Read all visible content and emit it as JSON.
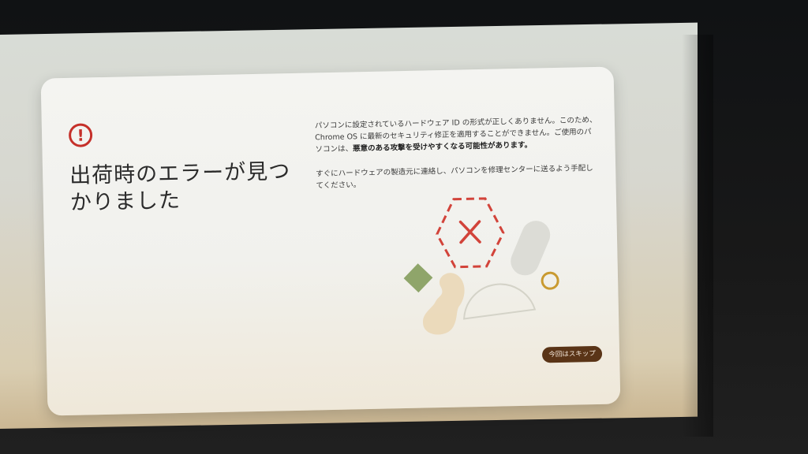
{
  "dialog": {
    "title": "出荷時のエラーが見つかりました",
    "description": {
      "p1_normal": "パソコンに設定されているハードウェア ID の形式が正しくありません。このため、Chrome OS に最新のセキュリティ修正を適用することができません。ご使用のパソコンは、",
      "p1_bold": "悪意のある攻撃を受けやすくなる可能性があります。",
      "p2": "すぐにハードウェアの製造元に連絡し、パソコンを修理センターに送るよう手配してください。"
    },
    "skip_label": "今回はスキップ"
  },
  "icons": {
    "alert": "alert-circle-icon",
    "error_x": "close-x-icon"
  },
  "colors": {
    "alert_red": "#c5302a",
    "skip_button_bg": "#5a3417",
    "leaf_green": "#8fa56a",
    "ring_gold": "#c99a30",
    "peanut_beige": "#ead6b4",
    "capsule_gray": "#dcdcd6"
  }
}
